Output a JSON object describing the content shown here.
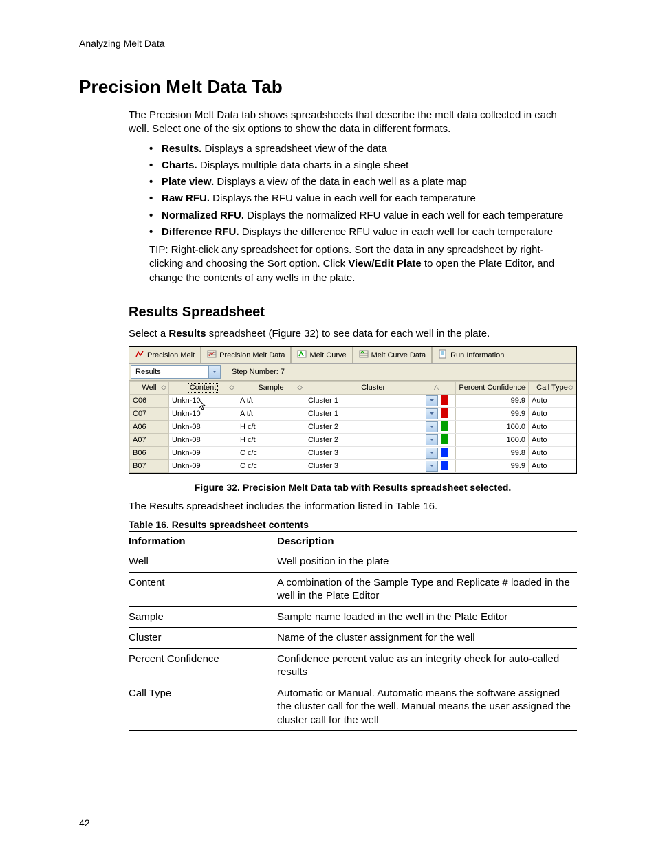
{
  "running_head": "Analyzing Melt Data",
  "page_number": "42",
  "h1": "Precision Melt Data Tab",
  "intro": "The Precision Melt Data tab shows spreadsheets that describe the melt data collected in each well. Select one of the six options to show the data in different formats.",
  "opts": [
    {
      "b": "Results.",
      "t": " Displays a spreadsheet view of the data"
    },
    {
      "b": "Charts.",
      "t": " Displays multiple data charts in a single sheet"
    },
    {
      "b": "Plate view.",
      "t": " Displays a view of the data in each well as a plate map"
    },
    {
      "b": "Raw RFU.",
      "t": " Displays the RFU value in each well for each temperature"
    },
    {
      "b": "Normalized RFU.",
      "t": " Displays the normalized RFU value in each well for each temperature"
    },
    {
      "b": "Difference RFU.",
      "t": " Displays the difference RFU value in each well for each temperature"
    }
  ],
  "tip_a": "TIP: Right-click any spreadsheet for options. Sort the data in any spreadsheet by right-clicking and choosing the Sort option. Click ",
  "tip_b": "View/Edit Plate",
  "tip_c": " to open the Plate Editor, and change the contents of any wells in the plate.",
  "h2": "Results Spreadsheet",
  "rs_a": "Select a ",
  "rs_b": "Results",
  "rs_c": " spreadsheet (Figure 32) to see data for each well in the plate.",
  "tabs": [
    "Precision Melt",
    "Precision Melt Data",
    "Melt Curve",
    "Melt Curve Data",
    "Run Information"
  ],
  "combo_value": "Results",
  "step_label": "Step Number:  7",
  "grid_headers": [
    "Well",
    "Content",
    "Sample",
    "Cluster",
    "Percent Confidence",
    "Call Type"
  ],
  "sort_glyph_up": "△",
  "sort_glyph": "◇",
  "rows": [
    {
      "well": "C06",
      "content": "Unkn-10",
      "sample": "A t/t",
      "cluster": "Cluster 1",
      "color": "#d40000",
      "pc": "99.9",
      "ct": "Auto"
    },
    {
      "well": "C07",
      "content": "Unkn-10",
      "sample": "A t/t",
      "cluster": "Cluster 1",
      "color": "#d40000",
      "pc": "99.9",
      "ct": "Auto"
    },
    {
      "well": "A06",
      "content": "Unkn-08",
      "sample": "H c/t",
      "cluster": "Cluster 2",
      "color": "#00a000",
      "pc": "100.0",
      "ct": "Auto"
    },
    {
      "well": "A07",
      "content": "Unkn-08",
      "sample": "H c/t",
      "cluster": "Cluster 2",
      "color": "#00a000",
      "pc": "100.0",
      "ct": "Auto"
    },
    {
      "well": "B06",
      "content": "Unkn-09",
      "sample": "C c/c",
      "cluster": "Cluster 3",
      "color": "#0030ff",
      "pc": "99.8",
      "ct": "Auto"
    },
    {
      "well": "B07",
      "content": "Unkn-09",
      "sample": "C c/c",
      "cluster": "Cluster 3",
      "color": "#0030ff",
      "pc": "99.9",
      "ct": "Auto"
    }
  ],
  "fig_caption": "Figure 32. Precision Melt Data tab with Results spreadsheet selected.",
  "after_fig": "The Results spreadsheet includes the information listed in Table 16.",
  "tbl_caption": "Table 16. Results spreadsheet contents",
  "desc_head": [
    "Information",
    "Description"
  ],
  "desc": [
    {
      "k": "Well",
      "v": "Well position in the plate"
    },
    {
      "k": "Content",
      "v": "A combination of the Sample Type and Replicate # loaded in the well in the Plate Editor"
    },
    {
      "k": "Sample",
      "v": "Sample name loaded in the well in the Plate Editor"
    },
    {
      "k": "Cluster",
      "v": "Name of the cluster assignment for the well"
    },
    {
      "k": "Percent Confidence",
      "v": "Confidence percent value as an integrity check for auto-called results"
    },
    {
      "k": "Call Type",
      "v": "Automatic or Manual. Automatic means the software assigned the cluster call for the well. Manual means the user assigned the cluster call for the well"
    }
  ]
}
